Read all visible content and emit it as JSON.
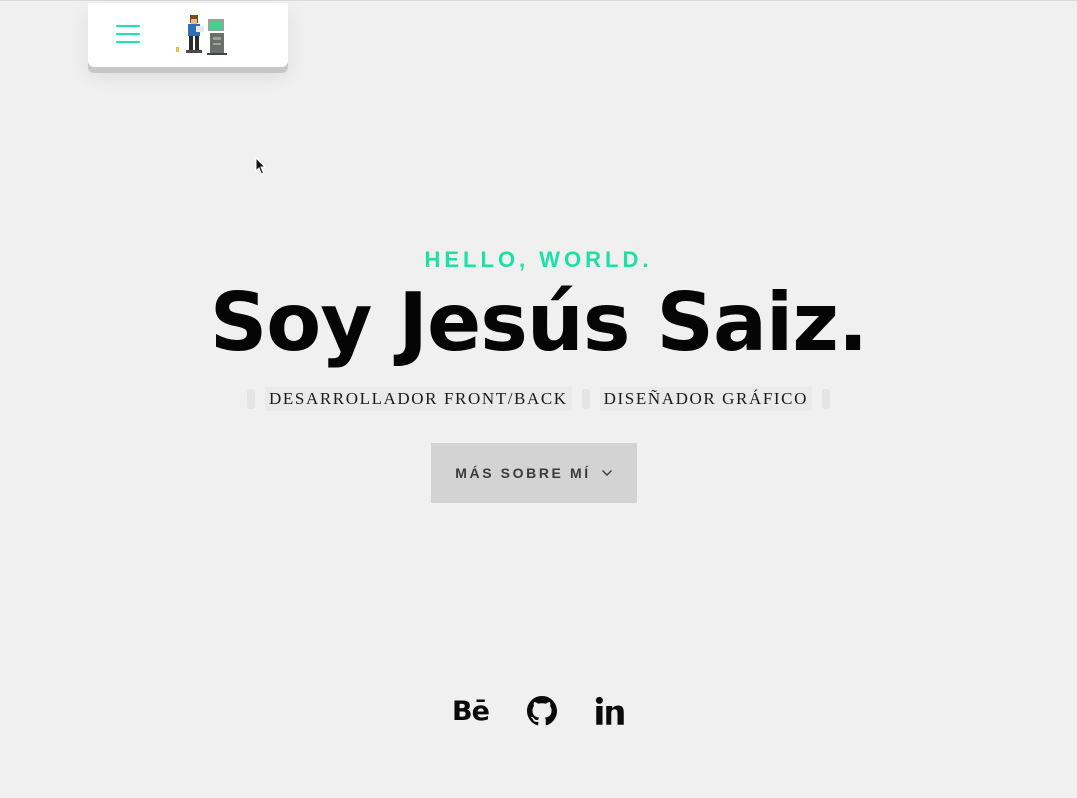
{
  "nav": {
    "menu_icon": "hamburger-icon",
    "logo_icon": "pixel-developer-logo",
    "accent_color": "#1ee0b2"
  },
  "hero": {
    "eyebrow": "HELLO, WORLD.",
    "title": "Soy Jesús Saiz.",
    "roles": [
      "DESARROLLADOR FRONT/BACK",
      "DISEÑADOR GRÁFICO"
    ],
    "cta_label": "MÁS SOBRE MÍ",
    "cta_icon": "chevron-down-icon"
  },
  "social": {
    "behance_text": "Bē",
    "items": [
      "behance-icon",
      "github-icon",
      "linkedin-icon"
    ]
  },
  "colors": {
    "background": "#eff0ef",
    "accent": "#1ee0a6",
    "cta_background": "#d3d3d3"
  }
}
